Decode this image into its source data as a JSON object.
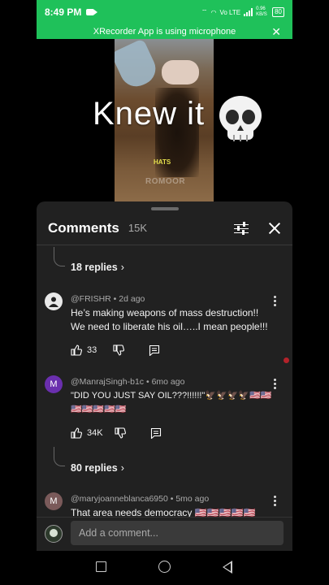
{
  "status": {
    "time": "8:49 PM",
    "network": "Vo LTE",
    "speed": "0.96 KB/S",
    "battery": "80"
  },
  "notification": {
    "text": "XRecorder App is using microphone"
  },
  "video": {
    "caption": "Knew it",
    "caption_emoji": "skull",
    "overlay_text": "HATS",
    "watermark": "ROMOOR"
  },
  "comments": {
    "title": "Comments",
    "count": "15K",
    "top_replies": {
      "label": "18 replies"
    },
    "items": [
      {
        "author": "@FRISHR",
        "time": "2d ago",
        "text": "He’s making weapons of mass destruction!! We need to liberate his oil…..I mean people!!!",
        "likes": "33",
        "avatar_letter": "",
        "avatar_color": "#e9e9e9"
      },
      {
        "author": "@ManrajSingh-b1c",
        "time": "6mo ago",
        "text": "\"DID YOU JUST SAY OIL???!!!!!!\"🦅🦅🦅🦅🇺🇸🇺🇸🇺🇸🇺🇸🇺🇸🇺🇸🇺🇸",
        "likes": "34K",
        "avatar_letter": "M",
        "avatar_color": "#6a2fae",
        "replies": "80 replies"
      },
      {
        "author": "@maryjoanneblanca6950",
        "time": "5mo ago",
        "text": "That area needs democracy 🇺🇸🇺🇸🇺🇸🇺🇸🇺🇸",
        "avatar_letter": "M",
        "avatar_color": "#7a5a5a"
      }
    ]
  },
  "compose": {
    "placeholder": "Add a comment..."
  },
  "colors": {
    "notification_bg": "#1fc15a",
    "sheet_bg": "#212121"
  }
}
